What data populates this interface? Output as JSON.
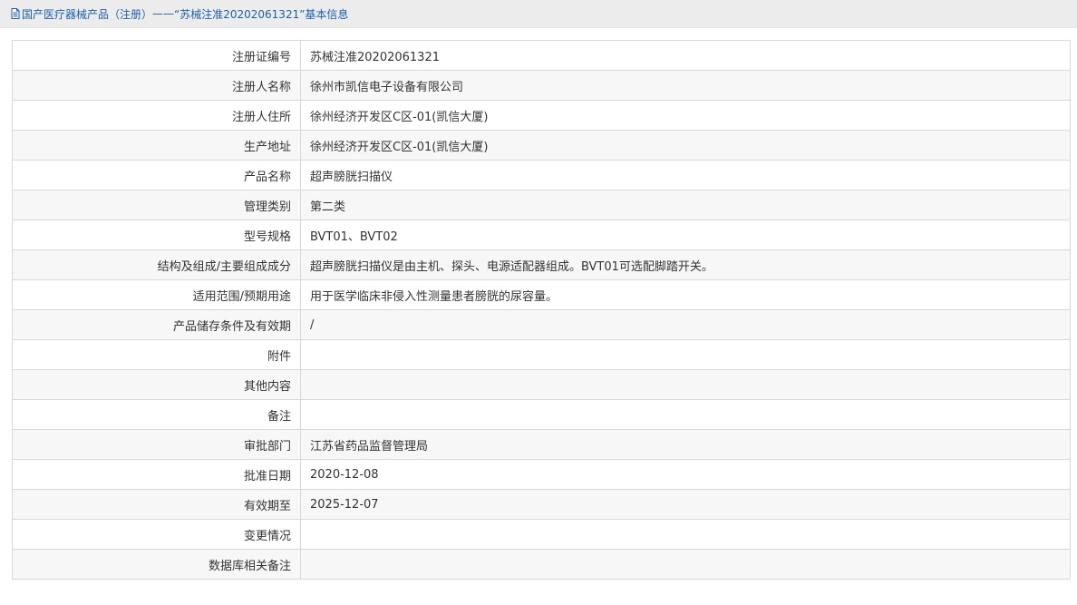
{
  "breadcrumb": {
    "parent": "国产医疗器械产品（注册）",
    "separator": " —— ",
    "current": "“苏械注准20202061321”基本信息"
  },
  "rows": [
    {
      "label": "注册证编号",
      "value": "苏械注准20202061321"
    },
    {
      "label": "注册人名称",
      "value": "徐州市凯信电子设备有限公司"
    },
    {
      "label": "注册人住所",
      "value": "徐州经济开发区C区-01(凯信大厦)"
    },
    {
      "label": "生产地址",
      "value": "徐州经济开发区C区-01(凯信大厦)"
    },
    {
      "label": "产品名称",
      "value": "超声膀胱扫描仪"
    },
    {
      "label": "管理类别",
      "value": "第二类"
    },
    {
      "label": "型号规格",
      "value": "BVT01、BVT02"
    },
    {
      "label": "结构及组成/主要组成成分",
      "value": "超声膀胱扫描仪是由主机、探头、电源适配器组成。BVT01可选配脚踏开关。"
    },
    {
      "label": "适用范围/预期用途",
      "value": "用于医学临床非侵入性测量患者膀胱的尿容量。"
    },
    {
      "label": "产品储存条件及有效期",
      "value": "/"
    },
    {
      "label": "附件",
      "value": ""
    },
    {
      "label": "其他内容",
      "value": ""
    },
    {
      "label": "备注",
      "value": ""
    },
    {
      "label": "审批部门",
      "value": "江苏省药品监督管理局"
    },
    {
      "label": "批准日期",
      "value": "2020-12-08"
    },
    {
      "label": "有效期至",
      "value": "2025-12-07"
    },
    {
      "label": "变更情况",
      "value": ""
    },
    {
      "label": "数据库相关备注",
      "value": ""
    }
  ]
}
